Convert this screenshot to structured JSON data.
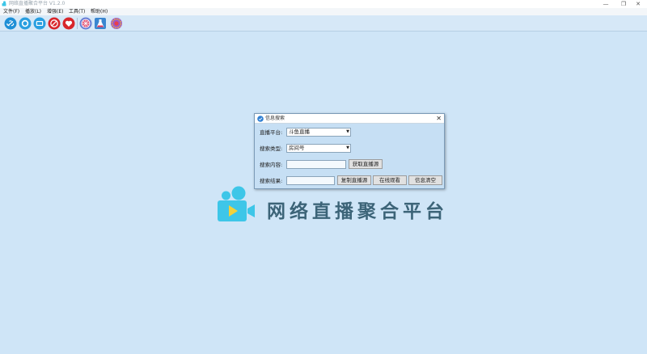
{
  "window": {
    "title": "网络直播聚合平台 V1.2.0",
    "minimize": "—",
    "restore": "❐",
    "close": "✕"
  },
  "menu": [
    {
      "label": "文件(F)"
    },
    {
      "label": "播放(L)"
    },
    {
      "label": "增强(E)"
    },
    {
      "label": "工具(T)"
    },
    {
      "label": "帮助(H)"
    }
  ],
  "toolbar": {
    "icons": [
      "link-icon",
      "live-icon",
      "tv-icon",
      "record-icon",
      "heart-icon",
      "globe-icon",
      "flask-icon",
      "gear-icon"
    ]
  },
  "dialog": {
    "title": "信息搜索",
    "close": "✕",
    "platform_label": "直播平台:",
    "platform_value": "斗鱼直播",
    "type_label": "搜索类型:",
    "type_value": "房间号",
    "content_label": "搜索内容:",
    "content_value": "",
    "get_source_button": "获取直播源",
    "result_label": "搜索结果:",
    "result_value": "",
    "copy_button": "复制直播源",
    "watch_button": "在线观看",
    "clear_button": "信息清空"
  },
  "logo": {
    "text": "网络直播聚合平台"
  },
  "colors": {
    "background": "#cfe5f7",
    "logo_blue": "#3ec6e8",
    "logo_yellow": "#f3d13a",
    "logo_text": "#3c6478"
  }
}
